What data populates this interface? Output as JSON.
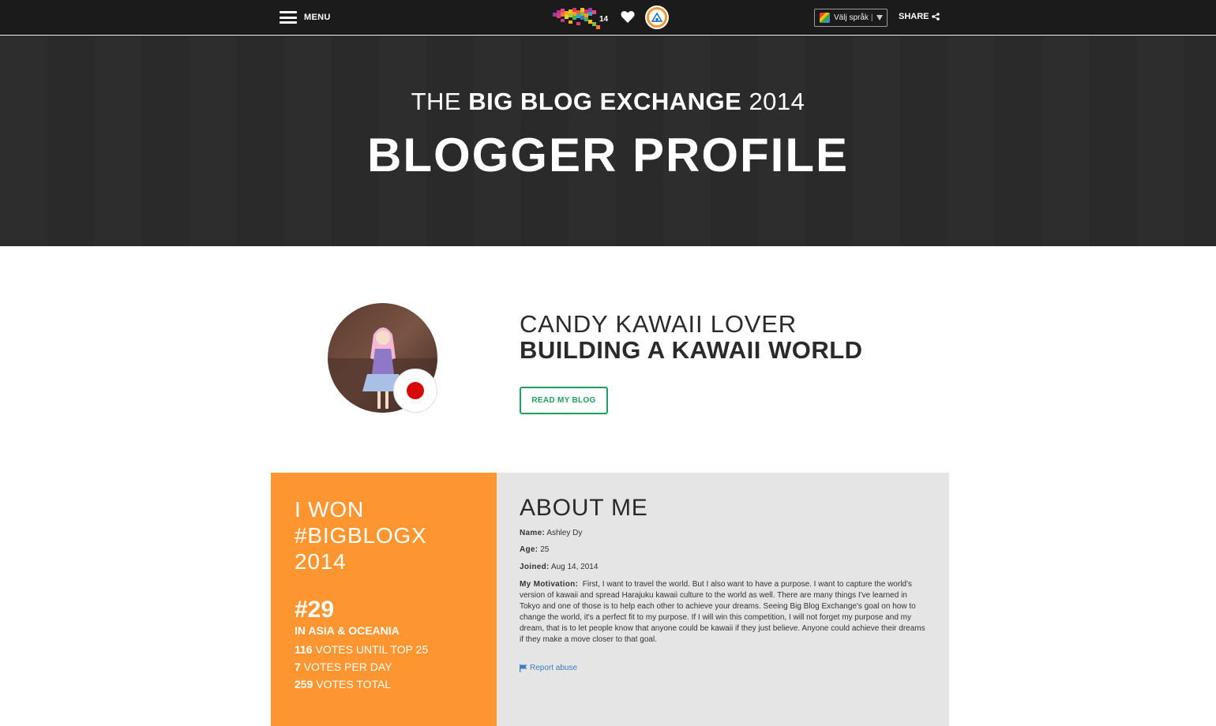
{
  "nav": {
    "menu_label": "MENU",
    "logo_number": "14",
    "language_label": "Välj språk",
    "language_sep": "|",
    "share_label": "SHARE"
  },
  "hero": {
    "pre": "THE",
    "brand": "BIG BLOG EXCHANGE",
    "year": "2014",
    "title": "BLOGGER PROFILE"
  },
  "profile": {
    "blog_name": "CANDY KAWAII LOVER",
    "tagline": "BUILDING A KAWAII WORLD",
    "read_button": "READ MY BLOG",
    "flag_color": "#d60a0a"
  },
  "stats": {
    "won_line1": "I WON",
    "won_line2": "#BIGBLOGX",
    "won_line3": "2014",
    "rank": "#29",
    "region": "IN ASIA & OCEANIA",
    "votes_until_num": "116",
    "votes_until_label": "VOTES UNTIL TOP 25",
    "votes_per_day_num": "7",
    "votes_per_day_label": "VOTES PER DAY",
    "votes_total_num": "259",
    "votes_total_label": "VOTES TOTAL",
    "accent_color": "#fd9630"
  },
  "about": {
    "title": "ABOUT ME",
    "name_label": "Name:",
    "name_value": "Ashley Dy",
    "age_label": "Age:",
    "age_value": "25",
    "joined_label": "Joined:",
    "joined_value": "Aug 14, 2014",
    "motivation_label": "My Motivation:",
    "motivation_text": "First, I want to travel the world. But I also want to have a purpose. I want to capture the world's version of kawaii and spread Harajuku kawaii culture to the world as well. There are many things I've learned in Tokyo and one of those is to help each other to achieve your dreams. Seeing Big Blog Exchange's goal on how to change the world, it's a perfect fit to my purpose. If I will win this competition, I will not forget my purpose and my dream, that is to let people know that anyone could be kawaii if they just believe. Anyone could achieve their dreams if they make a move closer to that goal.",
    "report_label": "Report abuse"
  }
}
